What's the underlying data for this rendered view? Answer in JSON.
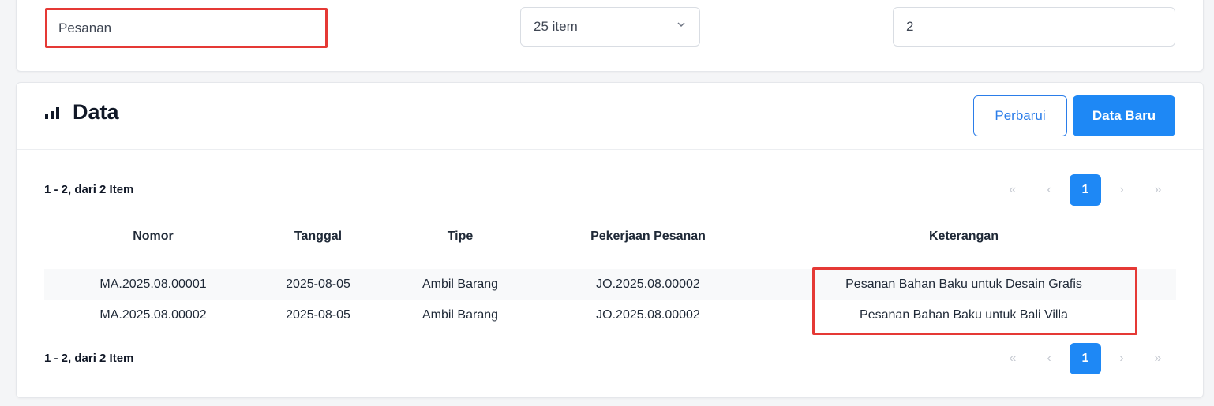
{
  "filters": {
    "search_value": "Pesanan",
    "per_page_value": "25 item",
    "count_value": "2"
  },
  "data_panel": {
    "title": "Data",
    "title_icon": "bar-chart-icon",
    "refresh_label": "Perbarui",
    "new_label": "Data Baru"
  },
  "summary": {
    "top": "1 - 2, dari 2 Item",
    "bottom": "1 - 2, dari 2 Item"
  },
  "pagination": {
    "first": "«",
    "prev": "‹",
    "current": "1",
    "next": "›",
    "last": "»"
  },
  "table": {
    "headers": {
      "nomor": "Nomor",
      "tanggal": "Tanggal",
      "tipe": "Tipe",
      "pekerjaan": "Pekerjaan Pesanan",
      "keterangan": "Keterangan"
    },
    "rows": [
      {
        "nomor": "MA.2025.08.00001",
        "tanggal": "2025-08-05",
        "tipe": "Ambil Barang",
        "pekerjaan": "JO.2025.08.00002",
        "keterangan": "Pesanan Bahan Baku untuk Desain Grafis"
      },
      {
        "nomor": "MA.2025.08.00002",
        "tanggal": "2025-08-05",
        "tipe": "Ambil Barang",
        "pekerjaan": "JO.2025.08.00002",
        "keterangan": "Pesanan Bahan Baku untuk Bali Villa"
      }
    ]
  },
  "colors": {
    "accent": "#1e88f5",
    "highlight": "#e53935"
  }
}
